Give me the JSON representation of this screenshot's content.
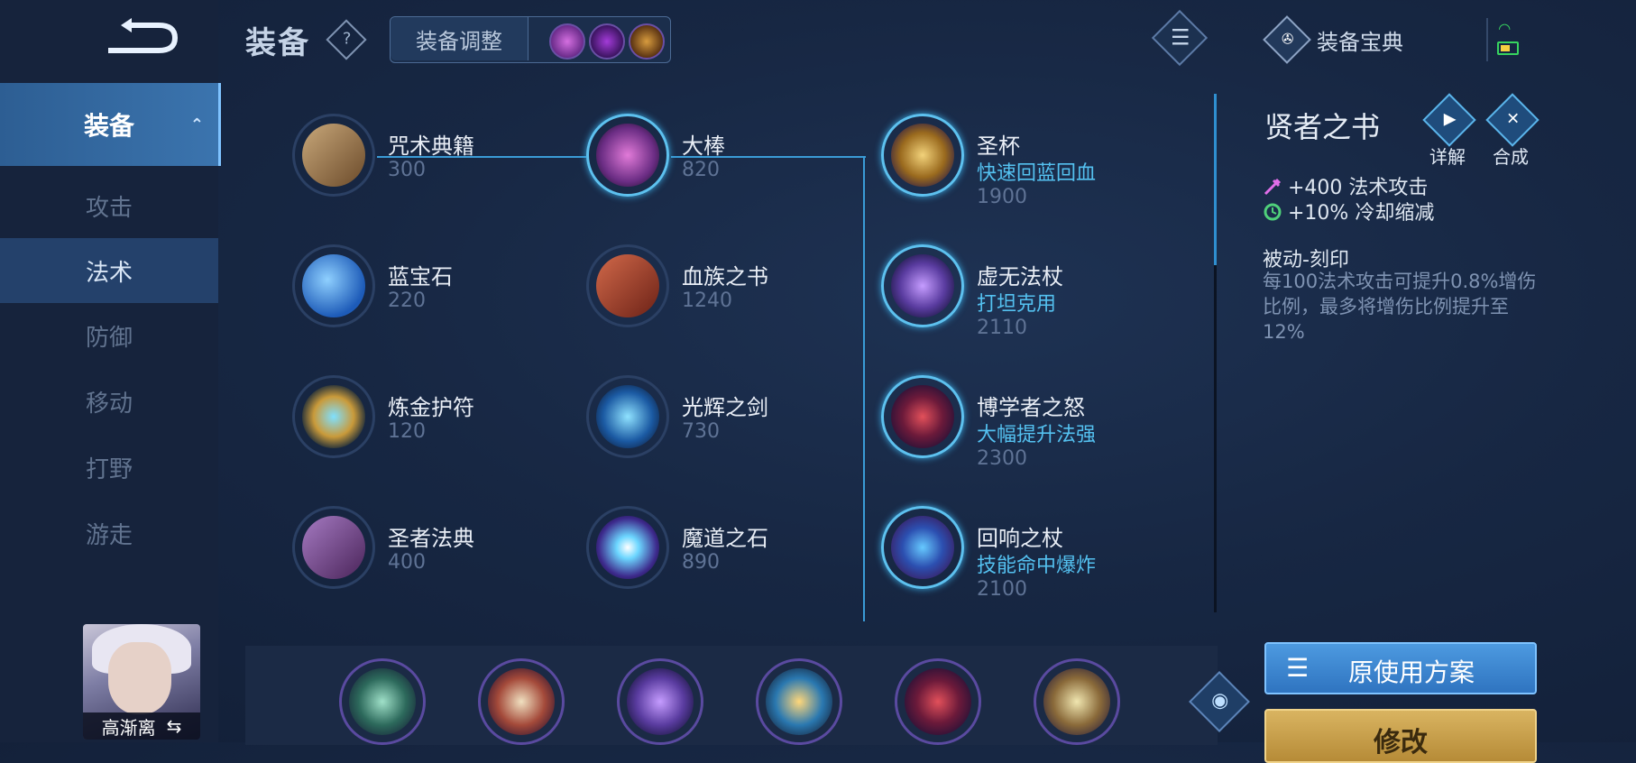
{
  "header": {
    "title": "装备",
    "adjust_label": "装备调整",
    "codex_label": "装备宝典"
  },
  "sidebar": {
    "items": [
      {
        "label": "装备"
      },
      {
        "label": "攻击"
      },
      {
        "label": "法术"
      },
      {
        "label": "防御"
      },
      {
        "label": "移动"
      },
      {
        "label": "打野"
      },
      {
        "label": "游走"
      }
    ],
    "selected": "法术"
  },
  "hero": {
    "name": "高渐离",
    "swap_icon": "⇆"
  },
  "items": {
    "col1": [
      {
        "name": "咒术典籍",
        "price": "300"
      },
      {
        "name": "蓝宝石",
        "price": "220"
      },
      {
        "name": "炼金护符",
        "price": "120"
      },
      {
        "name": "圣者法典",
        "price": "400"
      }
    ],
    "col2": [
      {
        "name": "大棒",
        "price": "820"
      },
      {
        "name": "血族之书",
        "price": "1240"
      },
      {
        "name": "光辉之剑",
        "price": "730"
      },
      {
        "name": "魔道之石",
        "price": "890"
      }
    ],
    "col3": [
      {
        "name": "圣杯",
        "tag": "快速回蓝回血",
        "price": "1900"
      },
      {
        "name": "虚无法杖",
        "tag": "打坦克用",
        "price": "2110"
      },
      {
        "name": "博学者之怒",
        "tag": "大幅提升法强",
        "price": "2300"
      },
      {
        "name": "回响之杖",
        "tag": "技能命中爆炸",
        "price": "2100"
      }
    ]
  },
  "detail": {
    "title": "贤者之书",
    "detail_label": "详解",
    "compose_label": "合成",
    "stats": [
      "+400 法术攻击",
      "+10% 冷却缩减"
    ],
    "passive_title": "被动-刻印",
    "passive_desc": "每100法术攻击可提升0.8%增伤比例，最多将增伤比例提升至12%"
  },
  "actions": {
    "plan_label": "原使用方案",
    "modify_label": "修改"
  },
  "colors": {
    "accent": "#3a9bd6",
    "tag": "#54c1f0",
    "gold": "#d9b461"
  }
}
